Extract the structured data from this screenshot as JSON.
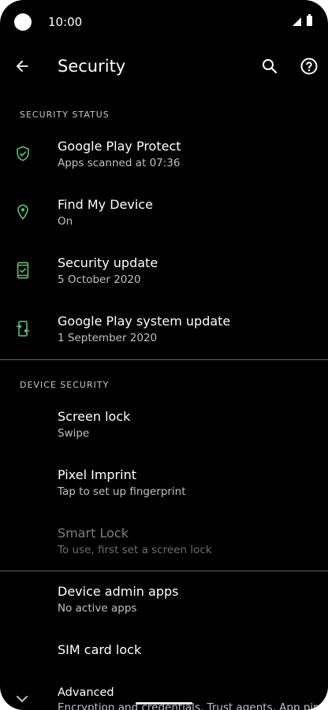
{
  "status_bar": {
    "time": "10:00"
  },
  "app_bar": {
    "title": "Security"
  },
  "colors": {
    "accent_green": "#5bb974",
    "background": "#000000",
    "text_primary": "#ffffff",
    "text_secondary": "#bdc1c6",
    "disabled": "#7c7f82"
  },
  "sections": {
    "security_status": "SECURITY STATUS",
    "device_security": "DEVICE SECURITY"
  },
  "status_items": [
    {
      "label": "Google Play Protect",
      "summary": "Apps scanned at 07:36",
      "icon": "shield-check-icon"
    },
    {
      "label": "Find My Device",
      "summary": "On",
      "icon": "location-pin-icon"
    },
    {
      "label": "Security update",
      "summary": "5 October 2020",
      "icon": "phone-check-icon"
    },
    {
      "label": "Google Play system update",
      "summary": "1 September 2020",
      "icon": "phone-sync-icon"
    }
  ],
  "device_items": [
    {
      "label": "Screen lock",
      "summary": "Swipe"
    },
    {
      "label": "Pixel Imprint",
      "summary": "Tap to set up fingerprint"
    },
    {
      "label": "Smart Lock",
      "summary": "To use, first set a screen lock",
      "disabled": true
    }
  ],
  "other_items": [
    {
      "label": "Device admin apps",
      "summary": "No active apps"
    },
    {
      "label": "SIM card lock",
      "summary": ""
    },
    {
      "label": "Advanced",
      "summary": "Encryption and credentials, Trust agents, App pinning"
    }
  ]
}
